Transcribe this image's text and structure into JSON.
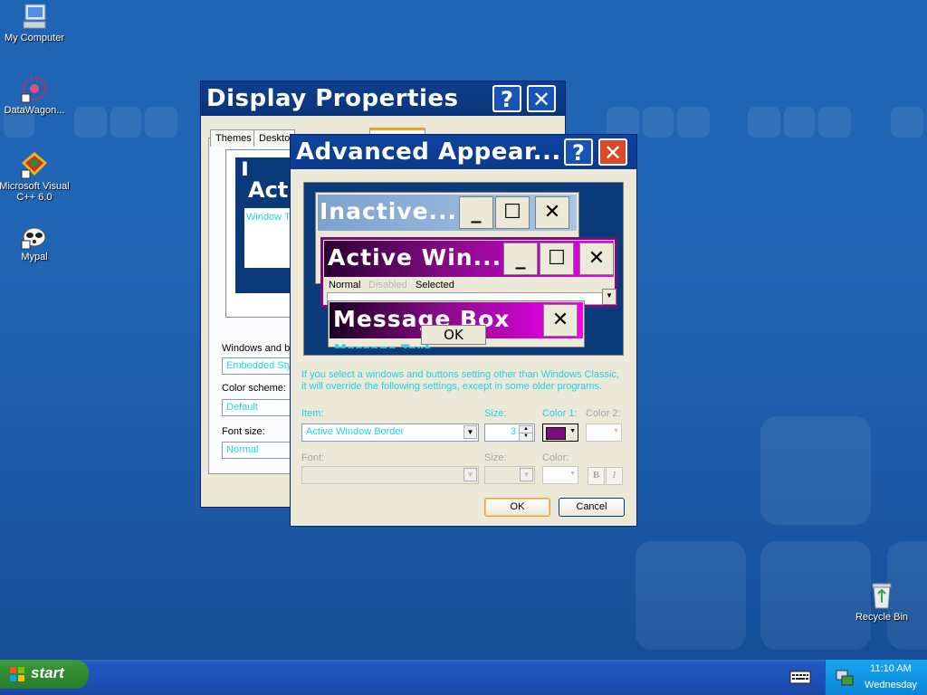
{
  "desktop": {
    "icons": [
      {
        "label": "My Computer",
        "icon": "computer-icon"
      },
      {
        "label": "DataWagon...",
        "icon": "datawagon-icon"
      },
      {
        "label": "Microsoft Visual C++ 6.0",
        "icon": "visual-cpp-icon"
      },
      {
        "label": "Mypal",
        "icon": "mypal-icon"
      },
      {
        "label": "Recycle Bin",
        "icon": "recycle-bin-icon"
      }
    ]
  },
  "display_properties": {
    "title": "Display Properties",
    "help_label": "?",
    "close_label": "✕",
    "tabs": [
      "Themes",
      "Deskto"
    ],
    "preview_inactive_letter": "I",
    "preview_active_title": "Act",
    "preview_window_text": "Window T",
    "windows_buttons_label": "Windows and bu",
    "windows_buttons_value": "Embedded Style",
    "color_scheme_label": "Color scheme:",
    "color_scheme_value": "Default",
    "font_size_label": "Font size:",
    "font_size_value": "Normal"
  },
  "advanced_appearance": {
    "title": "Advanced Appear...",
    "help_label": "?",
    "close_label": "✕",
    "preview": {
      "inactive_title": "Inactive...",
      "active_title": "Active Win...",
      "menu_normal": "Normal",
      "menu_disabled": "Disabled",
      "menu_selected": "Selected",
      "message_box_title": "Message Box",
      "ok_label": "OK",
      "message_text": "Message Text",
      "min_glyph": "_",
      "max_glyph": "☐",
      "close_glyph": "✕"
    },
    "info_text_line1": "If you select a windows and buttons setting other than Windows Classic,",
    "info_text_line2": "it will override the following settings, except in some older programs.",
    "item_label": "Item:",
    "item_value": "Active Window Border",
    "size_label": "Size:",
    "size_value": "3",
    "color1_label": "Color 1:",
    "color1_value": "#7b0c7e",
    "color2_label": "Color 2:",
    "font_label": "Font:",
    "font_size_label": "Size:",
    "font_color_label": "Color:",
    "bold_label": "B",
    "italic_label": "I",
    "ok_button": "OK",
    "cancel_button": "Cancel"
  },
  "taskbar": {
    "start_label": "start",
    "time": "11:10 AM",
    "day": "Wednesday"
  }
}
